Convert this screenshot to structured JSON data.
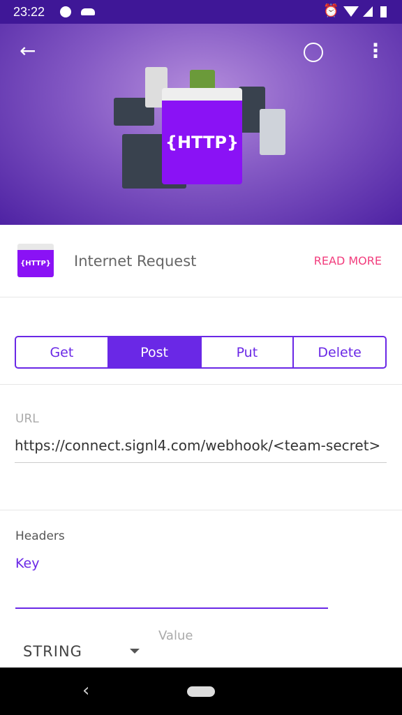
{
  "status": {
    "time": "23:22"
  },
  "toolbar": {
    "back": "←",
    "history": "🕓",
    "more": "⋮"
  },
  "hero": {
    "badge": "{HTTP}"
  },
  "header": {
    "logo": "{HTTP}",
    "title": "Internet Request",
    "read_more": "READ MORE"
  },
  "methods": [
    {
      "label": "Get"
    },
    {
      "label": "Post"
    },
    {
      "label": "Put"
    },
    {
      "label": "Delete"
    }
  ],
  "url": {
    "label": "URL",
    "value": "https://connect.signl4.com/webhook/<team-secret>"
  },
  "headers": {
    "label": "Headers",
    "key_placeholder": "Key",
    "type": "STRING",
    "value_placeholder": "Value"
  },
  "nav": {
    "back": "‹"
  }
}
